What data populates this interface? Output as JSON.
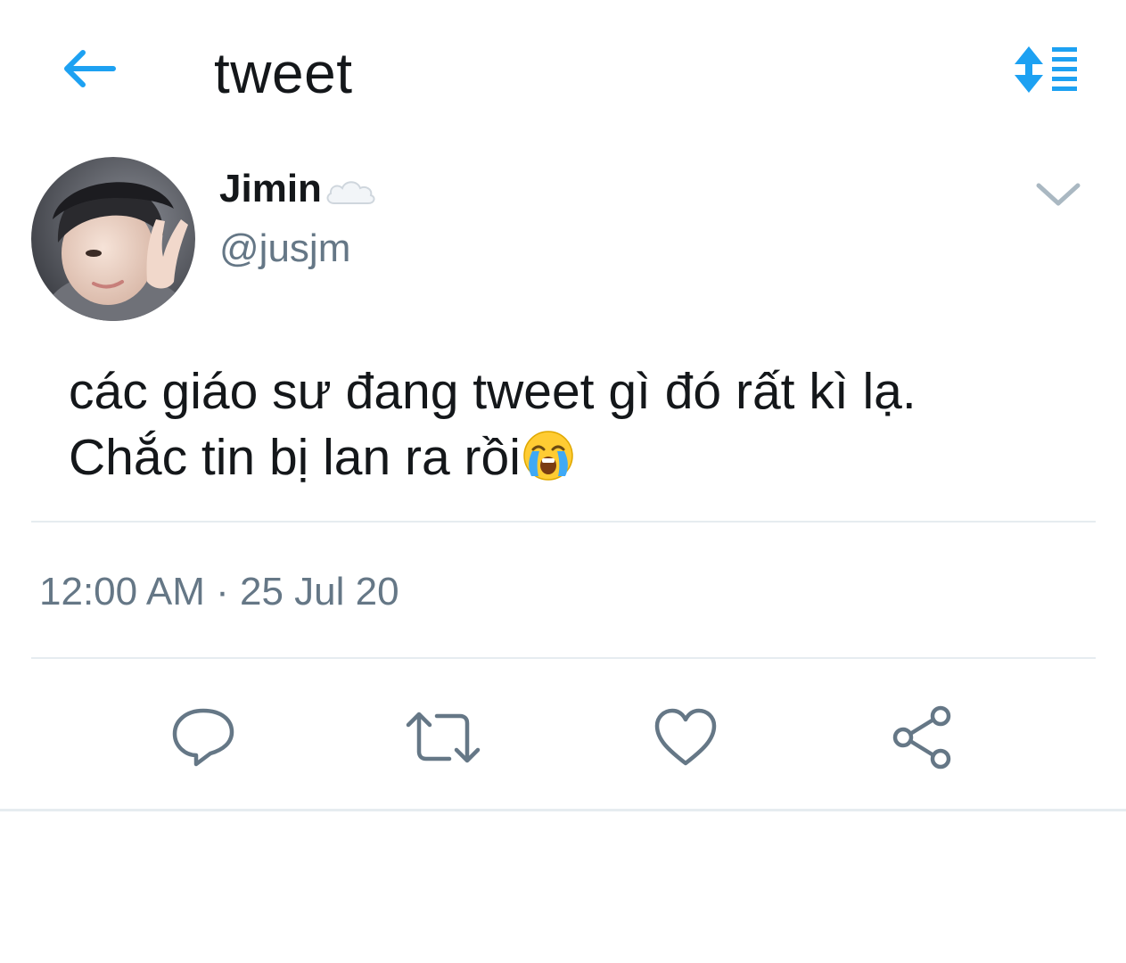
{
  "header": {
    "title": "tweet",
    "back_icon": "arrow-left-icon",
    "sort_icon": "sort-list-icon",
    "accent_color": "#1da1f2"
  },
  "author": {
    "display_name": "Jimin",
    "name_badge_icon": "cloud-icon",
    "handle": "@jusjm",
    "avatar": "profile-photo",
    "menu_icon": "chevron-down-icon"
  },
  "tweet": {
    "lines": [
      "các giáo sư đang tweet gì đó rất kì lạ.",
      "Chắc tin bị lan ra rồi"
    ],
    "emoji": "loudly-crying-face",
    "timestamp": "12:00 AM · 25 Jul 20"
  },
  "actions": [
    {
      "icon": "reply-icon"
    },
    {
      "icon": "retweet-icon"
    },
    {
      "icon": "like-heart-icon"
    },
    {
      "icon": "share-icon"
    }
  ],
  "colors": {
    "text_primary": "#14171a",
    "text_secondary": "#657786",
    "divider": "#e6ecf0",
    "icon_gray": "#657786"
  }
}
